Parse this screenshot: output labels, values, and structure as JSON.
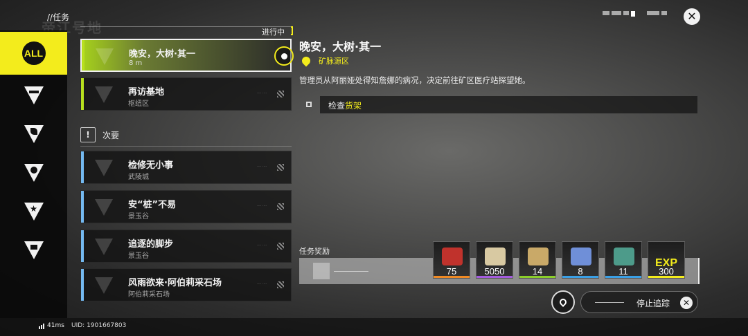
{
  "header": {
    "breadcrumb": "//任务",
    "bg_title": "帝江号地"
  },
  "sidebar": {
    "items": [
      {
        "label": "ALL",
        "icon": "all-badge-icon"
      },
      {
        "icon": "endfield-icon"
      },
      {
        "icon": "leaf-icon"
      },
      {
        "icon": "person-icon"
      },
      {
        "icon": "star-icon"
      },
      {
        "icon": "calendar-icon"
      }
    ]
  },
  "quest_list": {
    "in_progress_label": "进行中",
    "secondary_label": "次要",
    "main_quests": [
      {
        "title": "晚安，大树·其一",
        "sub": "8 m",
        "selected": true
      },
      {
        "title": "再访基地",
        "sub": "枢纽区",
        "selected": false
      }
    ],
    "secondary_quests": [
      {
        "title": "检修无小事",
        "sub": "武陵城"
      },
      {
        "title": "安“桩”不易",
        "sub": "景玉谷"
      },
      {
        "title": "追逐的脚步",
        "sub": "景玉谷"
      },
      {
        "title": "风雨欲来·阿伯莉采石场",
        "sub": "阿伯莉采石场"
      }
    ]
  },
  "detail": {
    "title": "晚安，大树·其一",
    "region": "矿脉源区",
    "description": "管理员从阿丽娅处得知詹娜的病况，决定前往矿区医疗站探望她。",
    "objective_prefix": "检查",
    "objective_highlight": "货架"
  },
  "rewards": {
    "label": "任务奖励",
    "items": [
      {
        "count": "75",
        "rarity_color": "#f08a24",
        "art_color": "#c0322c"
      },
      {
        "count": "5050",
        "rarity_color": "#a55ce0",
        "art_color": "#d8c9a2"
      },
      {
        "count": "14",
        "rarity_color": "#8bcf2a",
        "art_color": "#c9a968"
      },
      {
        "count": "8",
        "rarity_color": "#3aa0e6",
        "art_color": "#6f8fd8"
      },
      {
        "count": "11",
        "rarity_color": "#3aa0e6",
        "art_color": "#4d9b8a"
      },
      {
        "count": "300",
        "rarity_color": "#f3ec1c",
        "art_color": "#2a2a2a",
        "label": "EXP"
      }
    ]
  },
  "actions": {
    "stop_tracking": "停止追踪"
  },
  "status": {
    "ping": "41ms",
    "uid": "UID: 1901667803"
  },
  "colors": {
    "accent": "#f3ec1c",
    "main_strip": "#b8e01e",
    "secondary_strip": "#74b9f0"
  }
}
